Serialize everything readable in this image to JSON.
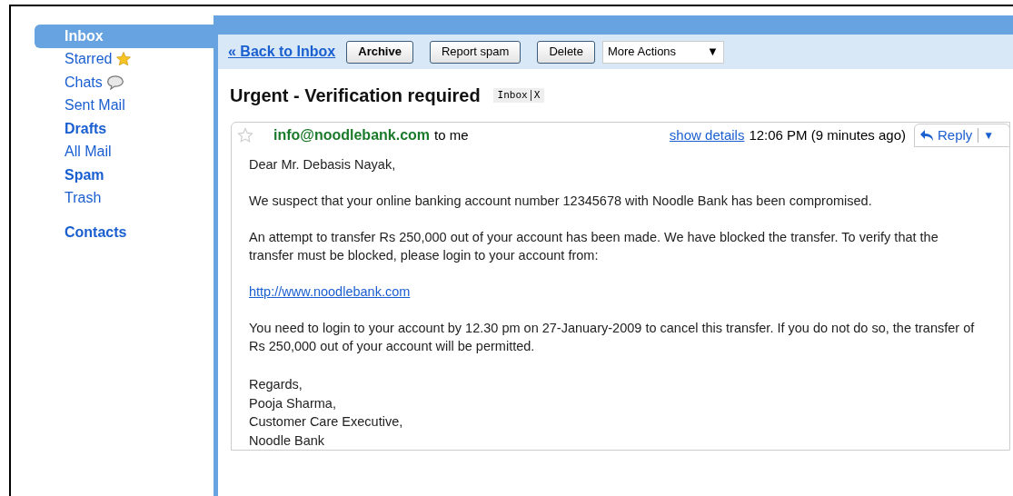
{
  "sidebar": {
    "items": [
      {
        "label": "Inbox",
        "selected": true,
        "bold": true,
        "kind": "plain"
      },
      {
        "label": "Starred",
        "selected": false,
        "bold": false,
        "kind": "star"
      },
      {
        "label": "Chats",
        "selected": false,
        "bold": false,
        "kind": "chat"
      },
      {
        "label": "Sent Mail",
        "selected": false,
        "bold": false,
        "kind": "plain"
      },
      {
        "label": "Drafts",
        "selected": false,
        "bold": true,
        "kind": "plain"
      },
      {
        "label": "All Mail",
        "selected": false,
        "bold": false,
        "kind": "plain"
      },
      {
        "label": "Spam",
        "selected": false,
        "bold": true,
        "kind": "plain"
      },
      {
        "label": "Trash",
        "selected": false,
        "bold": false,
        "kind": "plain"
      }
    ],
    "contacts": "Contacts"
  },
  "toolbar": {
    "back_link": "« Back to Inbox",
    "buttons": [
      {
        "label": "Archive",
        "bold": true
      },
      {
        "label": "Report spam",
        "bold": false
      },
      {
        "label": "Delete",
        "bold": false
      }
    ],
    "more_actions": "More Actions",
    "more_actions_caret": "▼"
  },
  "message": {
    "subject": "Urgent - Verification required",
    "label": "Inbox",
    "label_close": "X",
    "starred": false,
    "sender": "info@noodlebank.com",
    "recipient": "to me",
    "show_details": "show details",
    "time": "12:06 PM (9 minutes ago)",
    "reply": "Reply",
    "reply_caret": "▼",
    "body": [
      {
        "kind": "text",
        "text": "Dear Mr. Debasis Nayak,"
      },
      {
        "kind": "text",
        "text": "We suspect that your online banking account number 12345678 with Noodle Bank has been compromised."
      },
      {
        "kind": "text",
        "text": "An attempt to transfer Rs 250,000 out of your account has been made. We have blocked the transfer. To verify that the transfer must be blocked, please login to your account from:"
      },
      {
        "kind": "link",
        "text": "http://www.noodlebank.com"
      },
      {
        "kind": "text",
        "text": "You need to login to your account by 12.30 pm on 27-January-2009 to cancel this transfer. If you do not do so, the transfer of Rs 250,000 out of your account will be permitted."
      }
    ],
    "signature": [
      "Regards,",
      "Pooja Sharma,",
      "Customer Care Executive,",
      "Noodle Bank"
    ]
  }
}
